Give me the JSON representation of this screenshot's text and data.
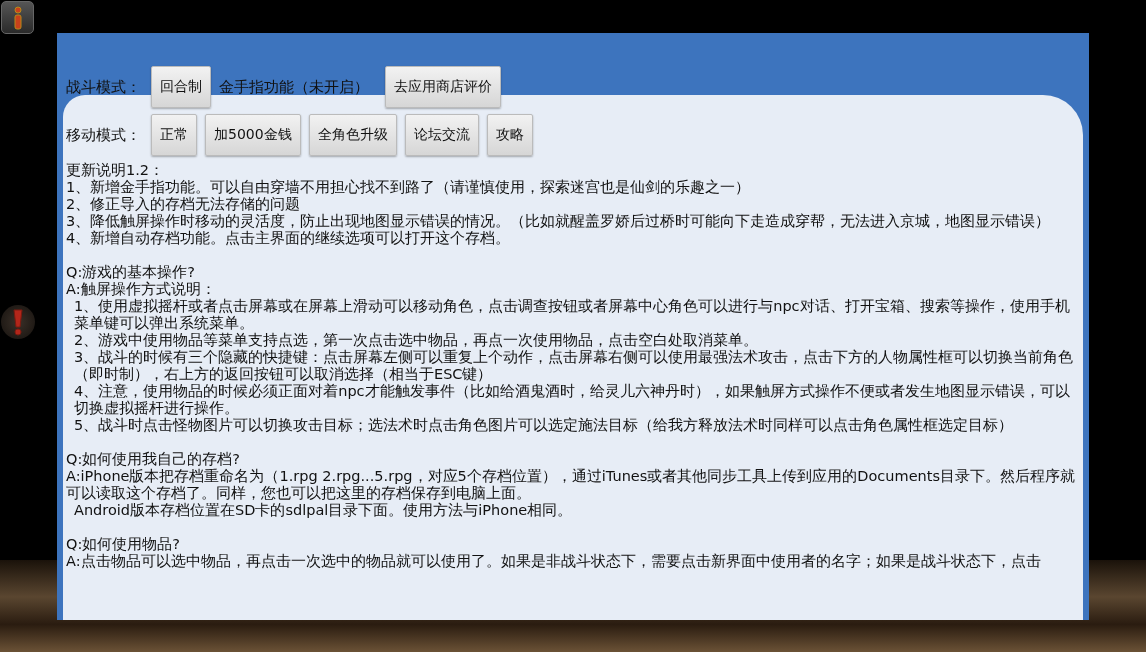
{
  "rows": [
    {
      "label": "战斗模式：",
      "items": [
        {
          "kind": "button",
          "text": "回合制"
        },
        {
          "kind": "text",
          "text": "金手指功能（未开启）"
        },
        {
          "kind": "button",
          "text": "去应用商店评价"
        }
      ]
    },
    {
      "label": "移动模式：",
      "items": [
        {
          "kind": "button",
          "text": "正常"
        },
        {
          "kind": "button",
          "text": "加5000金钱"
        },
        {
          "kind": "button",
          "text": "全角色升级"
        },
        {
          "kind": "button",
          "text": "论坛交流"
        },
        {
          "kind": "button",
          "text": "攻略"
        }
      ]
    }
  ],
  "sections": [
    [
      {
        "text": "更新说明1.2：",
        "indent": false
      },
      {
        "text": "1、新增金手指功能。可以自由穿墙不用担心找不到路了（请谨慎使用，探索迷宫也是仙剑的乐趣之一）",
        "indent": false
      },
      {
        "text": "2、修正导入的存档无法存储的问题",
        "indent": false
      },
      {
        "text": "3、降低触屏操作时移动的灵活度，防止出现地图显示错误的情况。（比如就醒盖罗娇后过桥时可能向下走造成穿帮，无法进入京城，地图显示错误）",
        "indent": false
      },
      {
        "text": "4、新增自动存档功能。点击主界面的继续选项可以打开这个存档。",
        "indent": false
      }
    ],
    [
      {
        "text": "Q:游戏的基本操作?",
        "indent": false
      },
      {
        "text": "A:触屏操作方式说明：",
        "indent": false
      },
      {
        "text": "1、使用虚拟摇杆或者点击屏幕或在屏幕上滑动可以移动角色，点击调查按钮或者屏幕中心角色可以进行与npc对话、打开宝箱、搜索等操作，使用手机菜单键可以弹出系统菜单。",
        "indent": true
      },
      {
        "text": "2、游戏中使用物品等菜单支持点选，第一次点击选中物品，再点一次使用物品，点击空白处取消菜单。",
        "indent": true
      },
      {
        "text": "3、战斗的时候有三个隐藏的快捷键：点击屏幕左侧可以重复上个动作，点击屏幕右侧可以使用最强法术攻击，点击下方的人物属性框可以切换当前角色（即时制），右上方的返回按钮可以取消选择（相当于ESC键）",
        "indent": true
      },
      {
        "text": "4、注意，使用物品的时候必须正面对着npc才能触发事件（比如给酒鬼酒时，给灵儿六神丹时），如果触屏方式操作不便或者发生地图显示错误，可以切换虚拟摇杆进行操作。",
        "indent": true
      },
      {
        "text": "5、战斗时点击怪物图片可以切换攻击目标；选法术时点击角色图片可以选定施法目标（给我方释放法术时同样可以点击角色属性框选定目标）",
        "indent": true
      }
    ],
    [
      {
        "text": "Q:如何使用我自己的存档?",
        "indent": false
      },
      {
        "text": "A:iPhone版本把存档重命名为（1.rpg 2.rpg...5.rpg，对应5个存档位置），通过iTunes或者其他同步工具上传到应用的Documents目录下。然后程序就可以读取这个存档了。同样，您也可以把这里的存档保存到电脑上面。",
        "indent": false
      },
      {
        "text": "Android版本存档位置在SD卡的sdlpal目录下面。使用方法与iPhone相同。",
        "indent": true
      }
    ],
    [
      {
        "text": "Q:如何使用物品?",
        "indent": false
      },
      {
        "text": "A:点击物品可以选中物品，再点击一次选中的物品就可以使用了。如果是非战斗状态下，需要点击新界面中使用者的名字；如果是战斗状态下，点击",
        "indent": false
      }
    ]
  ]
}
